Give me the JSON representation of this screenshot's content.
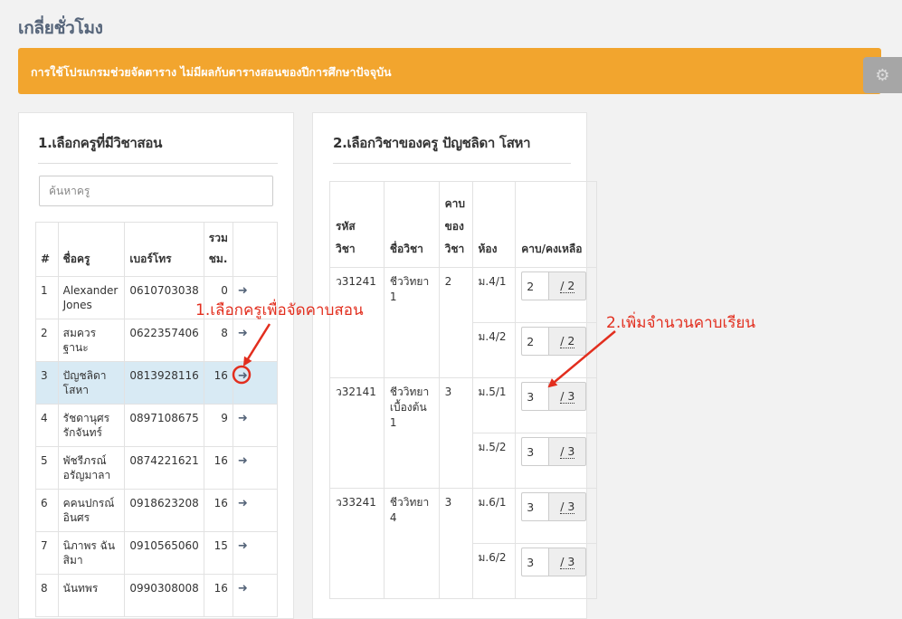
{
  "page": {
    "title": "เกลี่ยชั่วโมง"
  },
  "alert": {
    "message": "การใช้โปรแกรมช่วยจัดตาราง ไม่มีผลกับตารางสอนของปีการศึกษาปัจจุบัน"
  },
  "teacher_panel": {
    "heading": "1.เลือกครูที่มีวิชาสอน",
    "search_placeholder": "ค้นหาครู",
    "columns": {
      "index": "#",
      "name": "ชื่อครู",
      "phone": "เบอร์โทร",
      "total_line1": "รวม",
      "total_line2": "ชม."
    },
    "action_icon": "arrow-right-icon",
    "rows": [
      {
        "index": "1",
        "name": "Alexander Jones",
        "phone": "0610703038",
        "total": "0",
        "action": "➜"
      },
      {
        "index": "2",
        "name": "สมควร ฐานะ",
        "phone": "0622357406",
        "total": "8",
        "action": "➜"
      },
      {
        "index": "3",
        "name": "ปัญชลิดา โสหา",
        "phone": "0813928116",
        "total": "16",
        "action": "➜"
      },
      {
        "index": "4",
        "name": "รัชดานุศร รักจันทร์",
        "phone": "0897108675",
        "total": "9",
        "action": "➜"
      },
      {
        "index": "5",
        "name": "พัชรีภรณ์ อรัญมาลา",
        "phone": "0874221621",
        "total": "16",
        "action": "➜"
      },
      {
        "index": "6",
        "name": "คคนปกรณ์ อินศร",
        "phone": "0918623208",
        "total": "16",
        "action": "➜"
      },
      {
        "index": "7",
        "name": "นิภาพร ฉันสิมา",
        "phone": "0910565060",
        "total": "15",
        "action": "➜"
      },
      {
        "index": "8",
        "name": "นันทพร",
        "phone": "0990308008",
        "total": "16",
        "action": "➜"
      }
    ],
    "selected_index": "3"
  },
  "subject_panel": {
    "heading": "2.เลือกวิชาของครู ปัญชลิดา โสหา",
    "columns": {
      "code_line1": "รหัส",
      "code_line2": "วิชา",
      "name": "ชื่อวิชา",
      "periods_line1": "คาบ",
      "periods_line2": "ของ",
      "periods_line3": "วิชา",
      "room": "ห้อง",
      "remaining": "คาบ/คงเหลือ"
    },
    "subjects": [
      {
        "code": "ว31241",
        "name": "ชีววิทยา 1",
        "periods": "2",
        "rooms": [
          {
            "room": "ม.4/1",
            "value": "2",
            "total": "/ 2"
          },
          {
            "room": "ม.4/2",
            "value": "2",
            "total": "/ 2"
          }
        ]
      },
      {
        "code": "ว32141",
        "name": "ชีววิทยาเบื้องต้น 1",
        "periods": "3",
        "rooms": [
          {
            "room": "ม.5/1",
            "value": "3",
            "total": "/ 3"
          },
          {
            "room": "ม.5/2",
            "value": "3",
            "total": "/ 3"
          }
        ]
      },
      {
        "code": "ว33241",
        "name": "ชีววิทยา 4",
        "periods": "3",
        "rooms": [
          {
            "room": "ม.6/1",
            "value": "3",
            "total": "/ 3"
          },
          {
            "room": "ม.6/2",
            "value": "3",
            "total": "/ 3"
          }
        ]
      }
    ]
  },
  "annotations": {
    "note1": "1.เลือกครูเพื่อจัดคาบสอน",
    "note2": "2.เพิ่มจำนวนคาบเรียน",
    "color": "#e22e1e"
  },
  "settings_icon": "gear-icon",
  "colors": {
    "alert": "#f2a52e",
    "selected_row": "#d8eaf4",
    "title": "#56657a"
  }
}
